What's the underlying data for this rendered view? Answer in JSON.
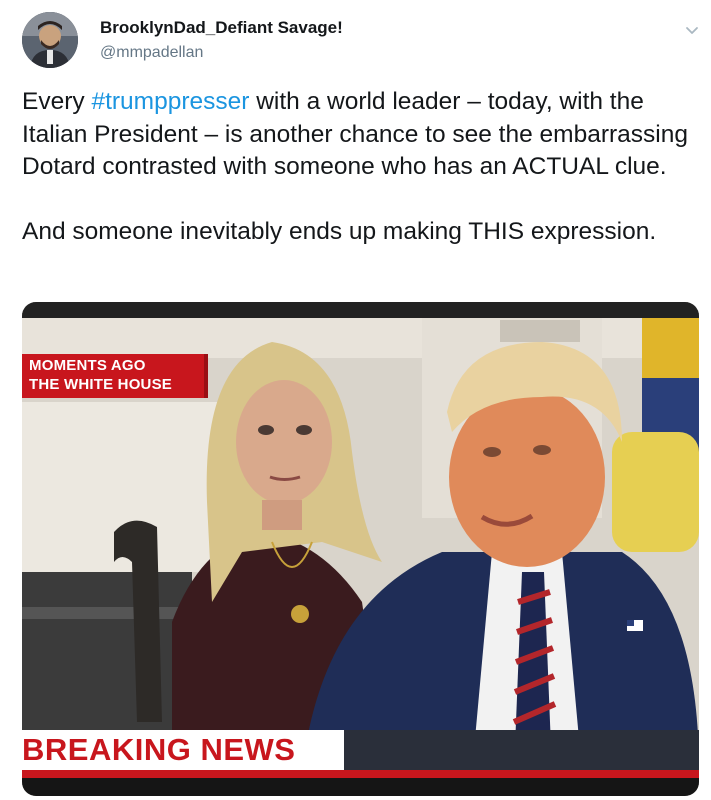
{
  "author": {
    "display_name": "BrooklynDad_Defiant Savage!",
    "handle": "@mmpadellan",
    "avatar_icon": "profile-avatar"
  },
  "menu_icon": "chevron-down-icon",
  "tweet": {
    "line1_before": "Every ",
    "hashtag": "#trumppresser",
    "line1_after": " with a world leader – today, with the Italian President – is another chance to see the embarrassing Dotard contrasted with someone who has an ACTUAL clue.",
    "paragraph2": "And someone inevitably ends up making THIS expression."
  },
  "media": {
    "chyron_line1": "MOMENTS AGO",
    "chyron_line2": "THE WHITE HOUSE",
    "breaking_label": "BREAKING NEWS"
  },
  "colors": {
    "link": "#1b95e0",
    "text": "#14171a",
    "secondary": "#657786",
    "news_red": "#c8161d"
  }
}
